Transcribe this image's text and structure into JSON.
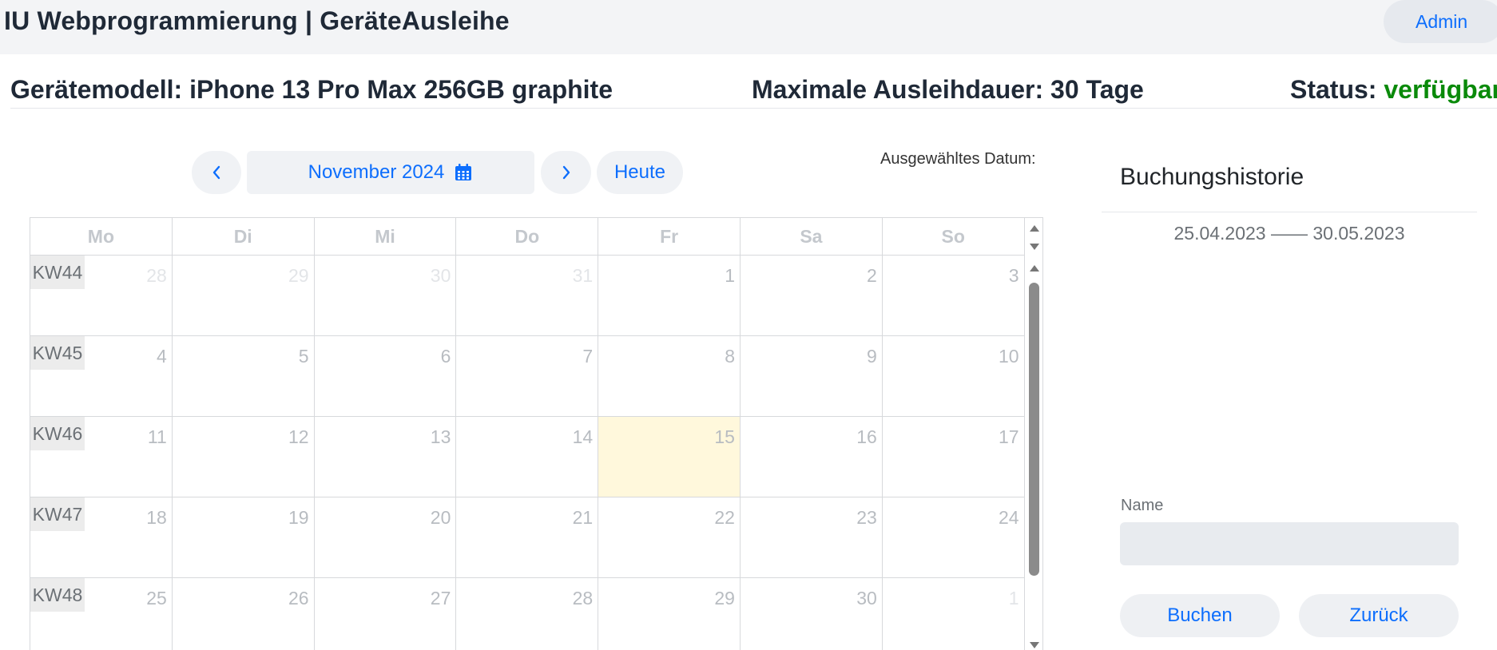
{
  "header": {
    "app_title": "IU Webprogrammierung | GeräteAusleihe",
    "admin_label": "Admin"
  },
  "info": {
    "model_label": "Gerätemodell: ",
    "model_value": "iPhone 13 Pro Max 256GB graphite",
    "duration_label": "Maximale Ausleihdauer: ",
    "duration_value": "30 Tage",
    "status_label": "Status: ",
    "status_value": "verfügbar",
    "status_color": "#0a8a0a"
  },
  "calendar_nav": {
    "prev_icon": "chevron-left-icon",
    "month_label": "November 2024",
    "calendar_icon": "calendar-icon",
    "next_icon": "chevron-right-icon",
    "today_label": "Heute"
  },
  "selected_date_label": "Ausgewähltes Datum:",
  "calendar": {
    "weekdays": [
      "Mo",
      "Di",
      "Mi",
      "Do",
      "Fr",
      "Sa",
      "So"
    ],
    "weeks": [
      {
        "kw": "KW44",
        "days": [
          {
            "num": "28",
            "faded": true
          },
          {
            "num": "29",
            "faded": true
          },
          {
            "num": "30",
            "faded": true
          },
          {
            "num": "31",
            "faded": true
          },
          {
            "num": "1",
            "faded": false
          },
          {
            "num": "2",
            "faded": false
          },
          {
            "num": "3",
            "faded": false
          }
        ]
      },
      {
        "kw": "KW45",
        "days": [
          {
            "num": "4",
            "faded": false
          },
          {
            "num": "5",
            "faded": false
          },
          {
            "num": "6",
            "faded": false
          },
          {
            "num": "7",
            "faded": false
          },
          {
            "num": "8",
            "faded": false
          },
          {
            "num": "9",
            "faded": false
          },
          {
            "num": "10",
            "faded": false
          }
        ]
      },
      {
        "kw": "KW46",
        "days": [
          {
            "num": "11",
            "faded": false
          },
          {
            "num": "12",
            "faded": false
          },
          {
            "num": "13",
            "faded": false
          },
          {
            "num": "14",
            "faded": false
          },
          {
            "num": "15",
            "faded": false,
            "today": true
          },
          {
            "num": "16",
            "faded": false
          },
          {
            "num": "17",
            "faded": false
          }
        ]
      },
      {
        "kw": "KW47",
        "days": [
          {
            "num": "18",
            "faded": false
          },
          {
            "num": "19",
            "faded": false
          },
          {
            "num": "20",
            "faded": false
          },
          {
            "num": "21",
            "faded": false
          },
          {
            "num": "22",
            "faded": false
          },
          {
            "num": "23",
            "faded": false
          },
          {
            "num": "24",
            "faded": false
          }
        ]
      },
      {
        "kw": "KW48",
        "days": [
          {
            "num": "25",
            "faded": false
          },
          {
            "num": "26",
            "faded": false
          },
          {
            "num": "27",
            "faded": false
          },
          {
            "num": "28",
            "faded": false
          },
          {
            "num": "29",
            "faded": false
          },
          {
            "num": "30",
            "faded": false
          },
          {
            "num": "1",
            "faded": true
          }
        ]
      }
    ],
    "today_color": "#fff8dc"
  },
  "history": {
    "title": "Buchungshistorie",
    "entries": [
      "25.04.2023 —— 30.05.2023"
    ]
  },
  "form": {
    "name_label": "Name",
    "name_value": "",
    "name_placeholder": "",
    "book_label": "Buchen",
    "back_label": "Zurück"
  },
  "colors": {
    "accent": "#0d6efd",
    "topbar_bg": "#f3f4f6"
  }
}
